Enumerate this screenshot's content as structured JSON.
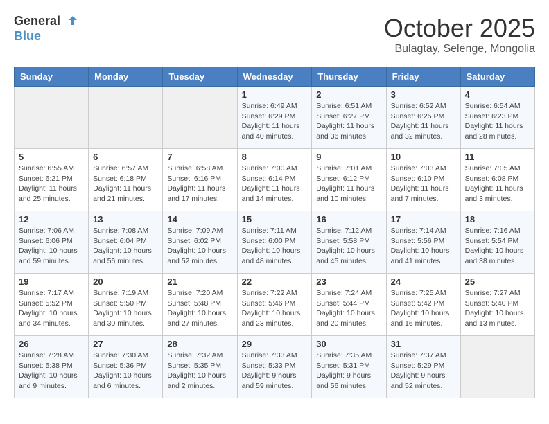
{
  "header": {
    "logo_line1": "General",
    "logo_line2": "Blue",
    "month": "October 2025",
    "location": "Bulagtay, Selenge, Mongolia"
  },
  "days_of_week": [
    "Sunday",
    "Monday",
    "Tuesday",
    "Wednesday",
    "Thursday",
    "Friday",
    "Saturday"
  ],
  "weeks": [
    [
      {
        "day": null,
        "info": null
      },
      {
        "day": null,
        "info": null
      },
      {
        "day": null,
        "info": null
      },
      {
        "day": "1",
        "info": "Sunrise: 6:49 AM\nSunset: 6:29 PM\nDaylight: 11 hours\nand 40 minutes."
      },
      {
        "day": "2",
        "info": "Sunrise: 6:51 AM\nSunset: 6:27 PM\nDaylight: 11 hours\nand 36 minutes."
      },
      {
        "day": "3",
        "info": "Sunrise: 6:52 AM\nSunset: 6:25 PM\nDaylight: 11 hours\nand 32 minutes."
      },
      {
        "day": "4",
        "info": "Sunrise: 6:54 AM\nSunset: 6:23 PM\nDaylight: 11 hours\nand 28 minutes."
      }
    ],
    [
      {
        "day": "5",
        "info": "Sunrise: 6:55 AM\nSunset: 6:21 PM\nDaylight: 11 hours\nand 25 minutes."
      },
      {
        "day": "6",
        "info": "Sunrise: 6:57 AM\nSunset: 6:18 PM\nDaylight: 11 hours\nand 21 minutes."
      },
      {
        "day": "7",
        "info": "Sunrise: 6:58 AM\nSunset: 6:16 PM\nDaylight: 11 hours\nand 17 minutes."
      },
      {
        "day": "8",
        "info": "Sunrise: 7:00 AM\nSunset: 6:14 PM\nDaylight: 11 hours\nand 14 minutes."
      },
      {
        "day": "9",
        "info": "Sunrise: 7:01 AM\nSunset: 6:12 PM\nDaylight: 11 hours\nand 10 minutes."
      },
      {
        "day": "10",
        "info": "Sunrise: 7:03 AM\nSunset: 6:10 PM\nDaylight: 11 hours\nand 7 minutes."
      },
      {
        "day": "11",
        "info": "Sunrise: 7:05 AM\nSunset: 6:08 PM\nDaylight: 11 hours\nand 3 minutes."
      }
    ],
    [
      {
        "day": "12",
        "info": "Sunrise: 7:06 AM\nSunset: 6:06 PM\nDaylight: 10 hours\nand 59 minutes."
      },
      {
        "day": "13",
        "info": "Sunrise: 7:08 AM\nSunset: 6:04 PM\nDaylight: 10 hours\nand 56 minutes."
      },
      {
        "day": "14",
        "info": "Sunrise: 7:09 AM\nSunset: 6:02 PM\nDaylight: 10 hours\nand 52 minutes."
      },
      {
        "day": "15",
        "info": "Sunrise: 7:11 AM\nSunset: 6:00 PM\nDaylight: 10 hours\nand 48 minutes."
      },
      {
        "day": "16",
        "info": "Sunrise: 7:12 AM\nSunset: 5:58 PM\nDaylight: 10 hours\nand 45 minutes."
      },
      {
        "day": "17",
        "info": "Sunrise: 7:14 AM\nSunset: 5:56 PM\nDaylight: 10 hours\nand 41 minutes."
      },
      {
        "day": "18",
        "info": "Sunrise: 7:16 AM\nSunset: 5:54 PM\nDaylight: 10 hours\nand 38 minutes."
      }
    ],
    [
      {
        "day": "19",
        "info": "Sunrise: 7:17 AM\nSunset: 5:52 PM\nDaylight: 10 hours\nand 34 minutes."
      },
      {
        "day": "20",
        "info": "Sunrise: 7:19 AM\nSunset: 5:50 PM\nDaylight: 10 hours\nand 30 minutes."
      },
      {
        "day": "21",
        "info": "Sunrise: 7:20 AM\nSunset: 5:48 PM\nDaylight: 10 hours\nand 27 minutes."
      },
      {
        "day": "22",
        "info": "Sunrise: 7:22 AM\nSunset: 5:46 PM\nDaylight: 10 hours\nand 23 minutes."
      },
      {
        "day": "23",
        "info": "Sunrise: 7:24 AM\nSunset: 5:44 PM\nDaylight: 10 hours\nand 20 minutes."
      },
      {
        "day": "24",
        "info": "Sunrise: 7:25 AM\nSunset: 5:42 PM\nDaylight: 10 hours\nand 16 minutes."
      },
      {
        "day": "25",
        "info": "Sunrise: 7:27 AM\nSunset: 5:40 PM\nDaylight: 10 hours\nand 13 minutes."
      }
    ],
    [
      {
        "day": "26",
        "info": "Sunrise: 7:28 AM\nSunset: 5:38 PM\nDaylight: 10 hours\nand 9 minutes."
      },
      {
        "day": "27",
        "info": "Sunrise: 7:30 AM\nSunset: 5:36 PM\nDaylight: 10 hours\nand 6 minutes."
      },
      {
        "day": "28",
        "info": "Sunrise: 7:32 AM\nSunset: 5:35 PM\nDaylight: 10 hours\nand 2 minutes."
      },
      {
        "day": "29",
        "info": "Sunrise: 7:33 AM\nSunset: 5:33 PM\nDaylight: 9 hours\nand 59 minutes."
      },
      {
        "day": "30",
        "info": "Sunrise: 7:35 AM\nSunset: 5:31 PM\nDaylight: 9 hours\nand 56 minutes."
      },
      {
        "day": "31",
        "info": "Sunrise: 7:37 AM\nSunset: 5:29 PM\nDaylight: 9 hours\nand 52 minutes."
      },
      {
        "day": null,
        "info": null
      }
    ]
  ]
}
